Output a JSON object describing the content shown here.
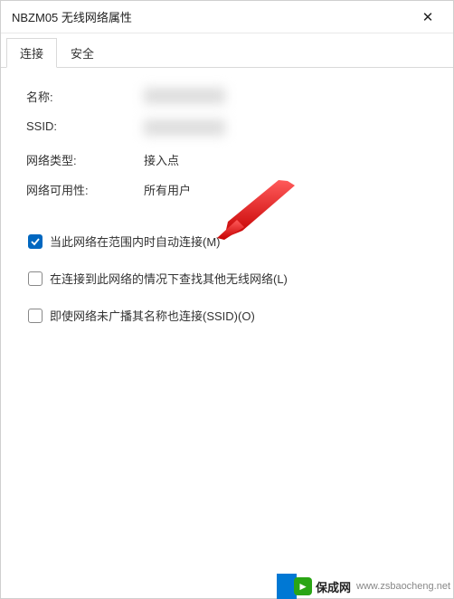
{
  "window": {
    "title": "NBZM05 无线网络属性"
  },
  "tabs": {
    "connection": "连接",
    "security": "安全"
  },
  "info": {
    "name_label": "名称:",
    "name_value": "",
    "ssid_label": "SSID:",
    "ssid_value": "",
    "type_label": "网络类型:",
    "type_value": "接入点",
    "availability_label": "网络可用性:",
    "availability_value": "所有用户"
  },
  "options": {
    "auto_connect": "当此网络在范围内时自动连接(M)",
    "look_other": "在连接到此网络的情况下查找其他无线网络(L)",
    "connect_hidden": "即使网络未广播其名称也连接(SSID)(O)"
  },
  "watermark": {
    "brand": "保成网",
    "url": "www.zsbaocheng.net"
  }
}
